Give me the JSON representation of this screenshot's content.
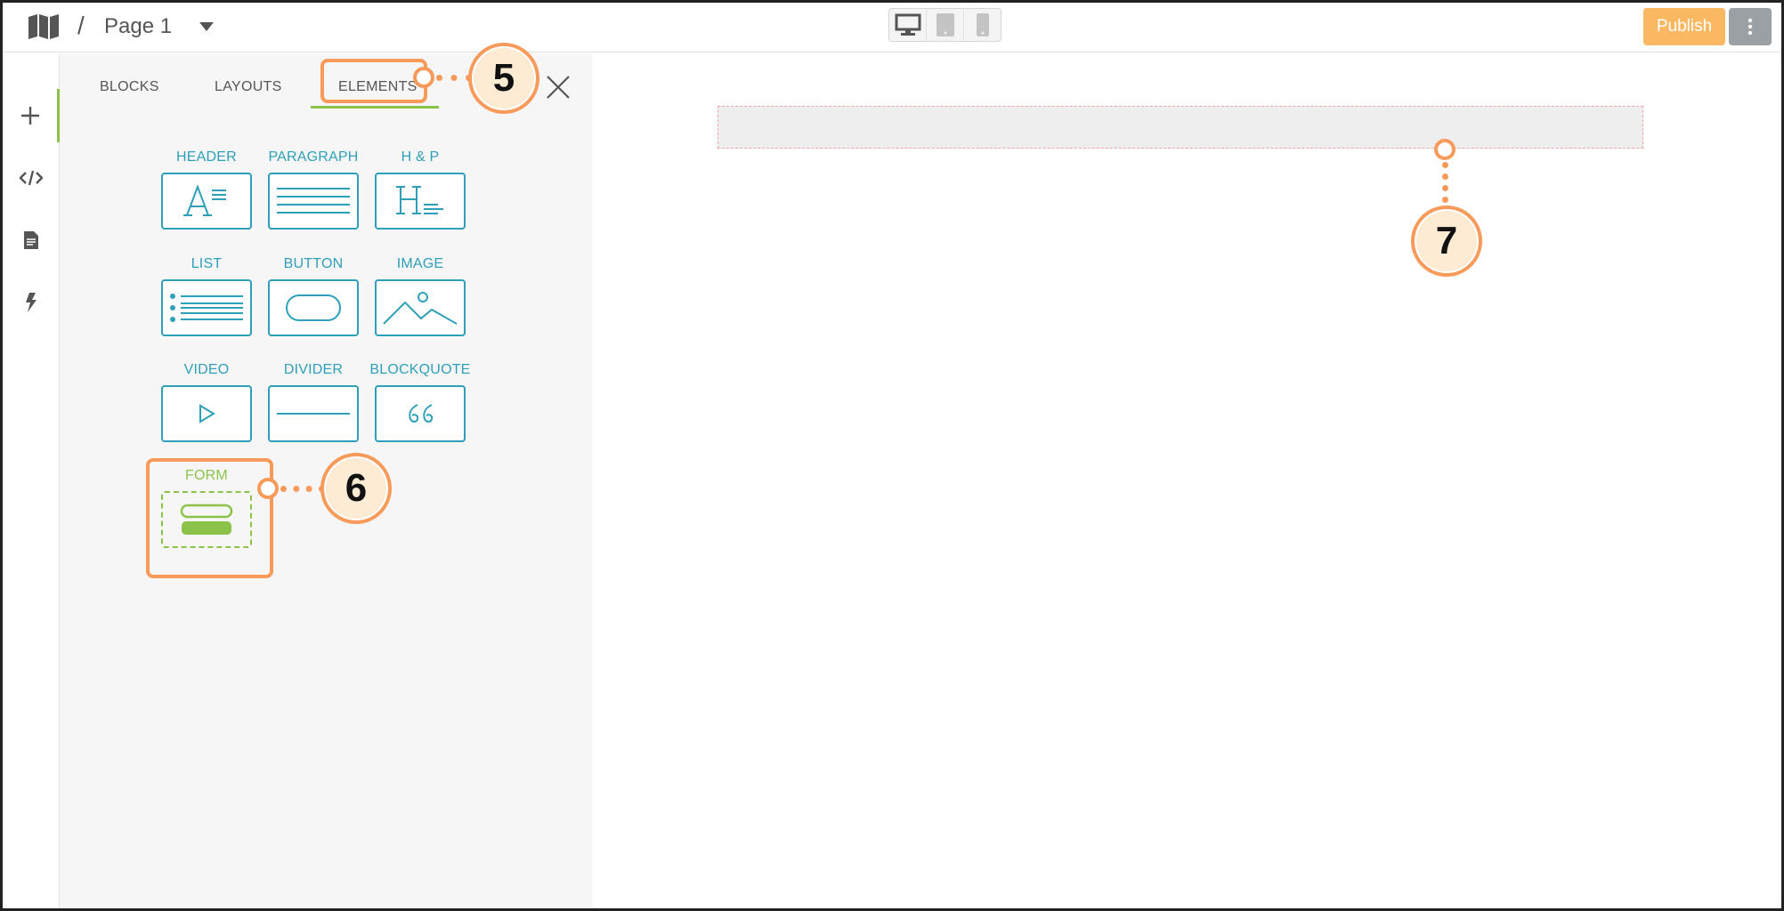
{
  "topbar": {
    "separator": "/",
    "page_title": "Page 1",
    "publish_label": "Publish"
  },
  "panel": {
    "tabs": [
      {
        "label": "BLOCKS"
      },
      {
        "label": "LAYOUTS"
      },
      {
        "label": "ELEMENTS",
        "active": true
      }
    ],
    "elements": [
      {
        "label": "HEADER",
        "icon": "header-icon"
      },
      {
        "label": "PARAGRAPH",
        "icon": "paragraph-icon"
      },
      {
        "label": "H & P",
        "icon": "heading-paragraph-icon"
      },
      {
        "label": "LIST",
        "icon": "list-icon"
      },
      {
        "label": "BUTTON",
        "icon": "button-shape-icon"
      },
      {
        "label": "IMAGE",
        "icon": "image-icon"
      },
      {
        "label": "VIDEO",
        "icon": "play-icon"
      },
      {
        "label": "DIVIDER",
        "icon": "divider-icon"
      },
      {
        "label": "BLOCKQUOTE",
        "icon": "quote-icon"
      },
      {
        "label": "FORM",
        "icon": "form-icon"
      }
    ]
  },
  "callouts": [
    {
      "number": "5"
    },
    {
      "number": "6"
    },
    {
      "number": "7"
    }
  ],
  "colors": {
    "accent_green": "#8bc34a",
    "element_blue": "#2e9fb8",
    "publish_orange": "#fbb862",
    "callout_orange": "#f79a5a"
  }
}
